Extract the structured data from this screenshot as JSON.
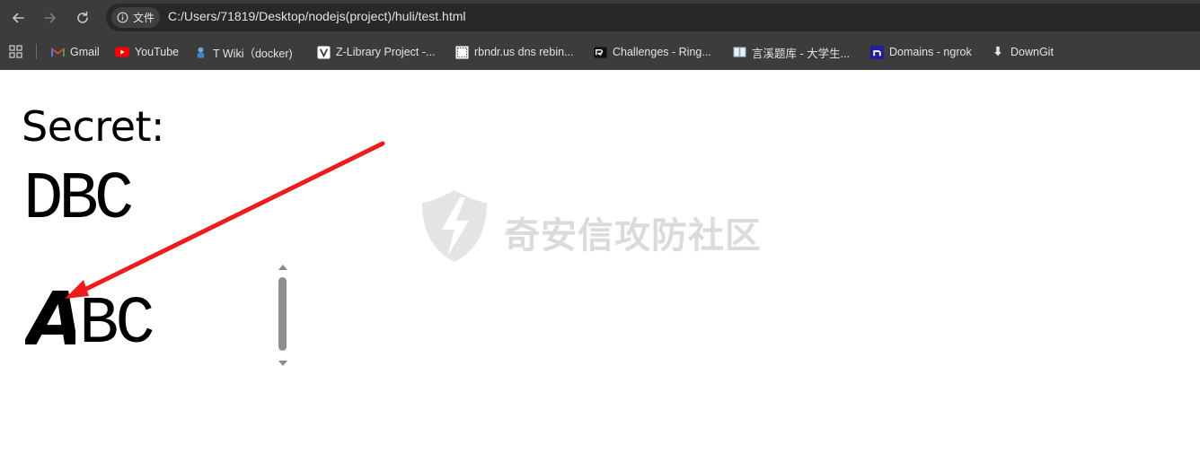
{
  "browser": {
    "site_chip_label": "文件",
    "url": "C:/Users/71819/Desktop/nodejs(project)/huli/test.html",
    "bookmarks": [
      {
        "label": "Gmail",
        "icon": "gmail-icon"
      },
      {
        "label": "YouTube",
        "icon": "youtube-icon"
      },
      {
        "label": "T Wiki（docker)",
        "icon": "wiki-icon"
      },
      {
        "label": "Z-Library Project -...",
        "icon": "zlibrary-icon"
      },
      {
        "label": "rbndr.us dns rebin...",
        "icon": "rbndr-icon"
      },
      {
        "label": "Challenges - Ring...",
        "icon": "ringzer0-icon"
      },
      {
        "label": "言溪题库 - 大学生...",
        "icon": "book-icon"
      },
      {
        "label": "Domains - ngrok",
        "icon": "ngrok-icon"
      },
      {
        "label": "DownGit",
        "icon": "download-icon"
      }
    ]
  },
  "page": {
    "secret_label": "Secret:",
    "secret_value": "DBC",
    "test_first_char": "A",
    "test_rest": "BC",
    "watermark_text": "奇安信攻防社区"
  },
  "colors": {
    "chrome_bg": "#3c3c3c",
    "omnibox_bg": "#282828",
    "annotation_arrow": "#ee1c1c",
    "text": "#000000"
  }
}
